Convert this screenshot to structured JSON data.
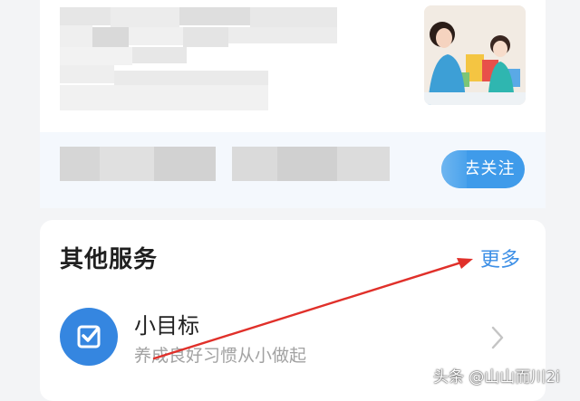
{
  "top_card": {
    "follow_button": "去关注"
  },
  "other_services": {
    "title": "其他服务",
    "more_label": "更多",
    "items": [
      {
        "icon": "checkbox-icon",
        "title": "小目标",
        "subtitle": "养成良好习惯从小做起"
      }
    ]
  },
  "watermark": "头条 @山山而川2i",
  "colors": {
    "accent": "#3586e0",
    "link": "#3d8fe6",
    "annotation_arrow": "#e0302a"
  }
}
